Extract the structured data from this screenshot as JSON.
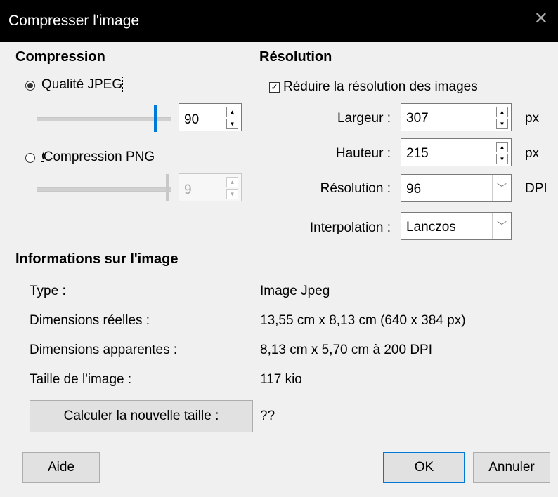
{
  "window": {
    "title": "Compresser l'image"
  },
  "compression": {
    "heading": "Compression",
    "jpeg_label": "Qualité JPEG",
    "jpeg_value": "90",
    "jpeg_slider_fraction": 0.9,
    "png_label": "Compression PNG",
    "png_value": "9",
    "png_slider_fraction": 1.0
  },
  "resolution": {
    "heading": "Résolution",
    "reduce_label": "Réduire la résolution des images",
    "reduce_checked": true,
    "width_label": "Largeur :",
    "width_value": "307",
    "width_unit": "px",
    "height_label": "Hauteur :",
    "height_value": "215",
    "height_unit": "px",
    "res_label": "Résolution :",
    "res_value": "96",
    "res_unit": "DPI",
    "interp_label": "Interpolation :",
    "interp_value": "Lanczos"
  },
  "info": {
    "heading": "Informations sur l'image",
    "type_label": "Type :",
    "type_value": "Image Jpeg",
    "real_label": "Dimensions réelles :",
    "real_value": "13,55 cm x 8,13 cm (640 x 384 px)",
    "apparent_label": "Dimensions apparentes :",
    "apparent_value": "8,13 cm x 5,70 cm à 200 DPI",
    "size_label": "Taille de l'image :",
    "size_value": "117 kio",
    "calc_button": "Calculer la nouvelle taille :",
    "new_size": "??"
  },
  "buttons": {
    "help": "Aide",
    "ok": "OK",
    "cancel": "Annuler"
  },
  "colors": {
    "accent": "#0078d7",
    "titlebar": "#000000"
  }
}
